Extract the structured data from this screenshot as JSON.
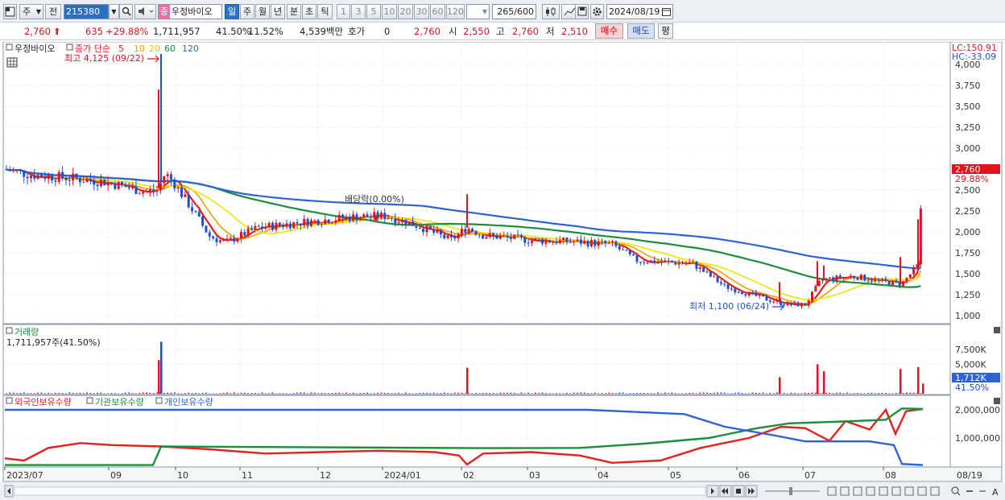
{
  "toolbar": {
    "market_select": "주",
    "prev_label": "전",
    "stock_code": "215380",
    "stock_name": "우정바이오",
    "stock_name_badge": "종",
    "period_buttons": [
      "일",
      "주",
      "월",
      "년",
      "분",
      "초",
      "틱"
    ],
    "interval_buttons": [
      "1",
      "3",
      "5",
      "10",
      "20",
      "30",
      "60",
      "120"
    ],
    "bar_count": "265",
    "bar_total": "/600",
    "date": "2024/08/19"
  },
  "quote": {
    "price": "2,760",
    "change": "635",
    "change_pct": "+29.88%",
    "volume": "1,711,957",
    "volume_ratio": "41.50%",
    "turnover": "11.52%",
    "amount": "4,539백만",
    "bid_label": "호가",
    "bid_value": "0",
    "bid_price": "2,760",
    "open_label": "시",
    "open": "2,550",
    "high_label": "고",
    "high": "2,760",
    "low_label": "저",
    "low": "2,510",
    "buy_button": "매수",
    "sell_button": "매도",
    "eval_button": "평"
  },
  "price_panel": {
    "title": "우정바이오",
    "legend_prefix": "종가 단순",
    "ma_labels": [
      "5",
      "10",
      "20",
      "60",
      "120"
    ],
    "ma_colors": [
      "#e8201c",
      "#f0a000",
      "#e8e800",
      "#1a8f3a",
      "#2e63d6"
    ],
    "lc_label": "LC:150.91",
    "hc_label": "HC:-33.09",
    "high_note": "최고 4,125 (09/22)",
    "low_note": "최저 1,100 (06/24)",
    "dividend_note": "배당락(0.00%)",
    "current_price_tag": "2,760",
    "current_pct_tag": "29.88%",
    "y_ticks": [
      "4,000",
      "3,750",
      "3,500",
      "3,250",
      "3,000",
      "2,750",
      "2,500",
      "2,250",
      "2,000",
      "1,750",
      "1,500",
      "1,250",
      "1,000"
    ]
  },
  "volume_panel": {
    "title": "거래량",
    "value_text": "1,711,957주(41.50%)",
    "y_ticks": [
      "7,500K",
      "5,000K"
    ],
    "current_tag": "1,712K",
    "current_pct": "41.50%"
  },
  "holding_panel": {
    "legend": [
      "외국인보유수량",
      "기관보유수량",
      "개인보유수량"
    ],
    "legend_colors": [
      "#e8201c",
      "#1a8f3a",
      "#2e63d6"
    ],
    "y_ticks": [
      "2,000,000",
      "1,000,000"
    ]
  },
  "x_axis": {
    "labels": [
      "2023/07",
      "09",
      "10",
      "11",
      "12",
      "2024/01",
      "02",
      "03",
      "04",
      "05",
      "06",
      "07",
      "08"
    ],
    "end_label": "08/19"
  },
  "colors": {
    "up": "#e0141e",
    "down": "#1d4fd2",
    "accent": "#2c74c9"
  }
}
